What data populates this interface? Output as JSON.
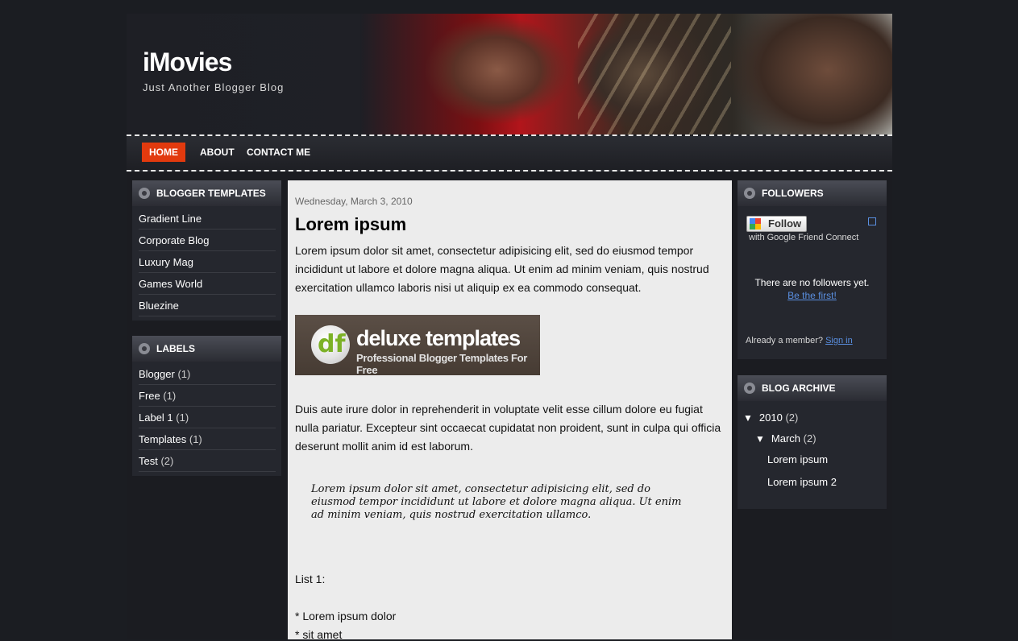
{
  "brand": {
    "title": "iMovies",
    "tagline": "Just Another Blogger Blog"
  },
  "nav": {
    "home": "HOME",
    "about": "ABOUT",
    "contact": "CONTACT ME"
  },
  "sidebar_left": {
    "templates": {
      "title": "BLOGGER TEMPLATES",
      "items": [
        "Gradient Line",
        "Corporate Blog",
        "Luxury Mag",
        "Games World",
        "Bluezine"
      ]
    },
    "labels": {
      "title": "LABELS",
      "items": [
        {
          "name": "Blogger",
          "count": "(1)"
        },
        {
          "name": "Free",
          "count": "(1)"
        },
        {
          "name": "Label 1",
          "count": "(1)"
        },
        {
          "name": "Templates",
          "count": "(1)"
        },
        {
          "name": "Test",
          "count": "(2)"
        }
      ]
    }
  },
  "post": {
    "date": "Wednesday, March 3, 2010",
    "title": "Lorem ipsum",
    "p1": "Lorem ipsum dolor sit amet, consectetur adipisicing elit, sed do eiusmod tempor incididunt ut labore et dolore magna aliqua. Ut enim ad minim veniam, quis nostrud exercitation ullamco laboris nisi ut aliquip ex ea commodo consequat.",
    "banner": {
      "logo": "df",
      "name": "deluxe templates",
      "sub": "Professional Blogger Templates For Free"
    },
    "p2": "Duis aute irure dolor in reprehenderit in voluptate velit esse cillum dolore eu fugiat nulla pariatur. Excepteur sint occaecat cupidatat non proident, sunt in culpa qui officia deserunt mollit anim id est laborum.",
    "quote": "Lorem ipsum dolor sit amet, consectetur adipisicing elit, sed do eiusmod tempor incididunt ut labore et dolore magna aliqua. Ut enim ad minim veniam, quis nostrud exercitation ullamco.",
    "list_label": "List 1:",
    "list": [
      "* Lorem ipsum dolor",
      "* sit amet"
    ]
  },
  "followers": {
    "title": "FOLLOWERS",
    "follow_button": "Follow",
    "gfc": "with Google Friend Connect",
    "none": "There are no followers yet.",
    "be_first": "Be the first!",
    "already": "Already a member?",
    "sign_in": "Sign in"
  },
  "archive": {
    "title": "BLOG ARCHIVE",
    "year": "2010",
    "year_count": "(2)",
    "month": "March",
    "month_count": "(2)",
    "posts": [
      "Lorem ipsum",
      "Lorem ipsum 2"
    ],
    "expanded_marker": "▼"
  }
}
